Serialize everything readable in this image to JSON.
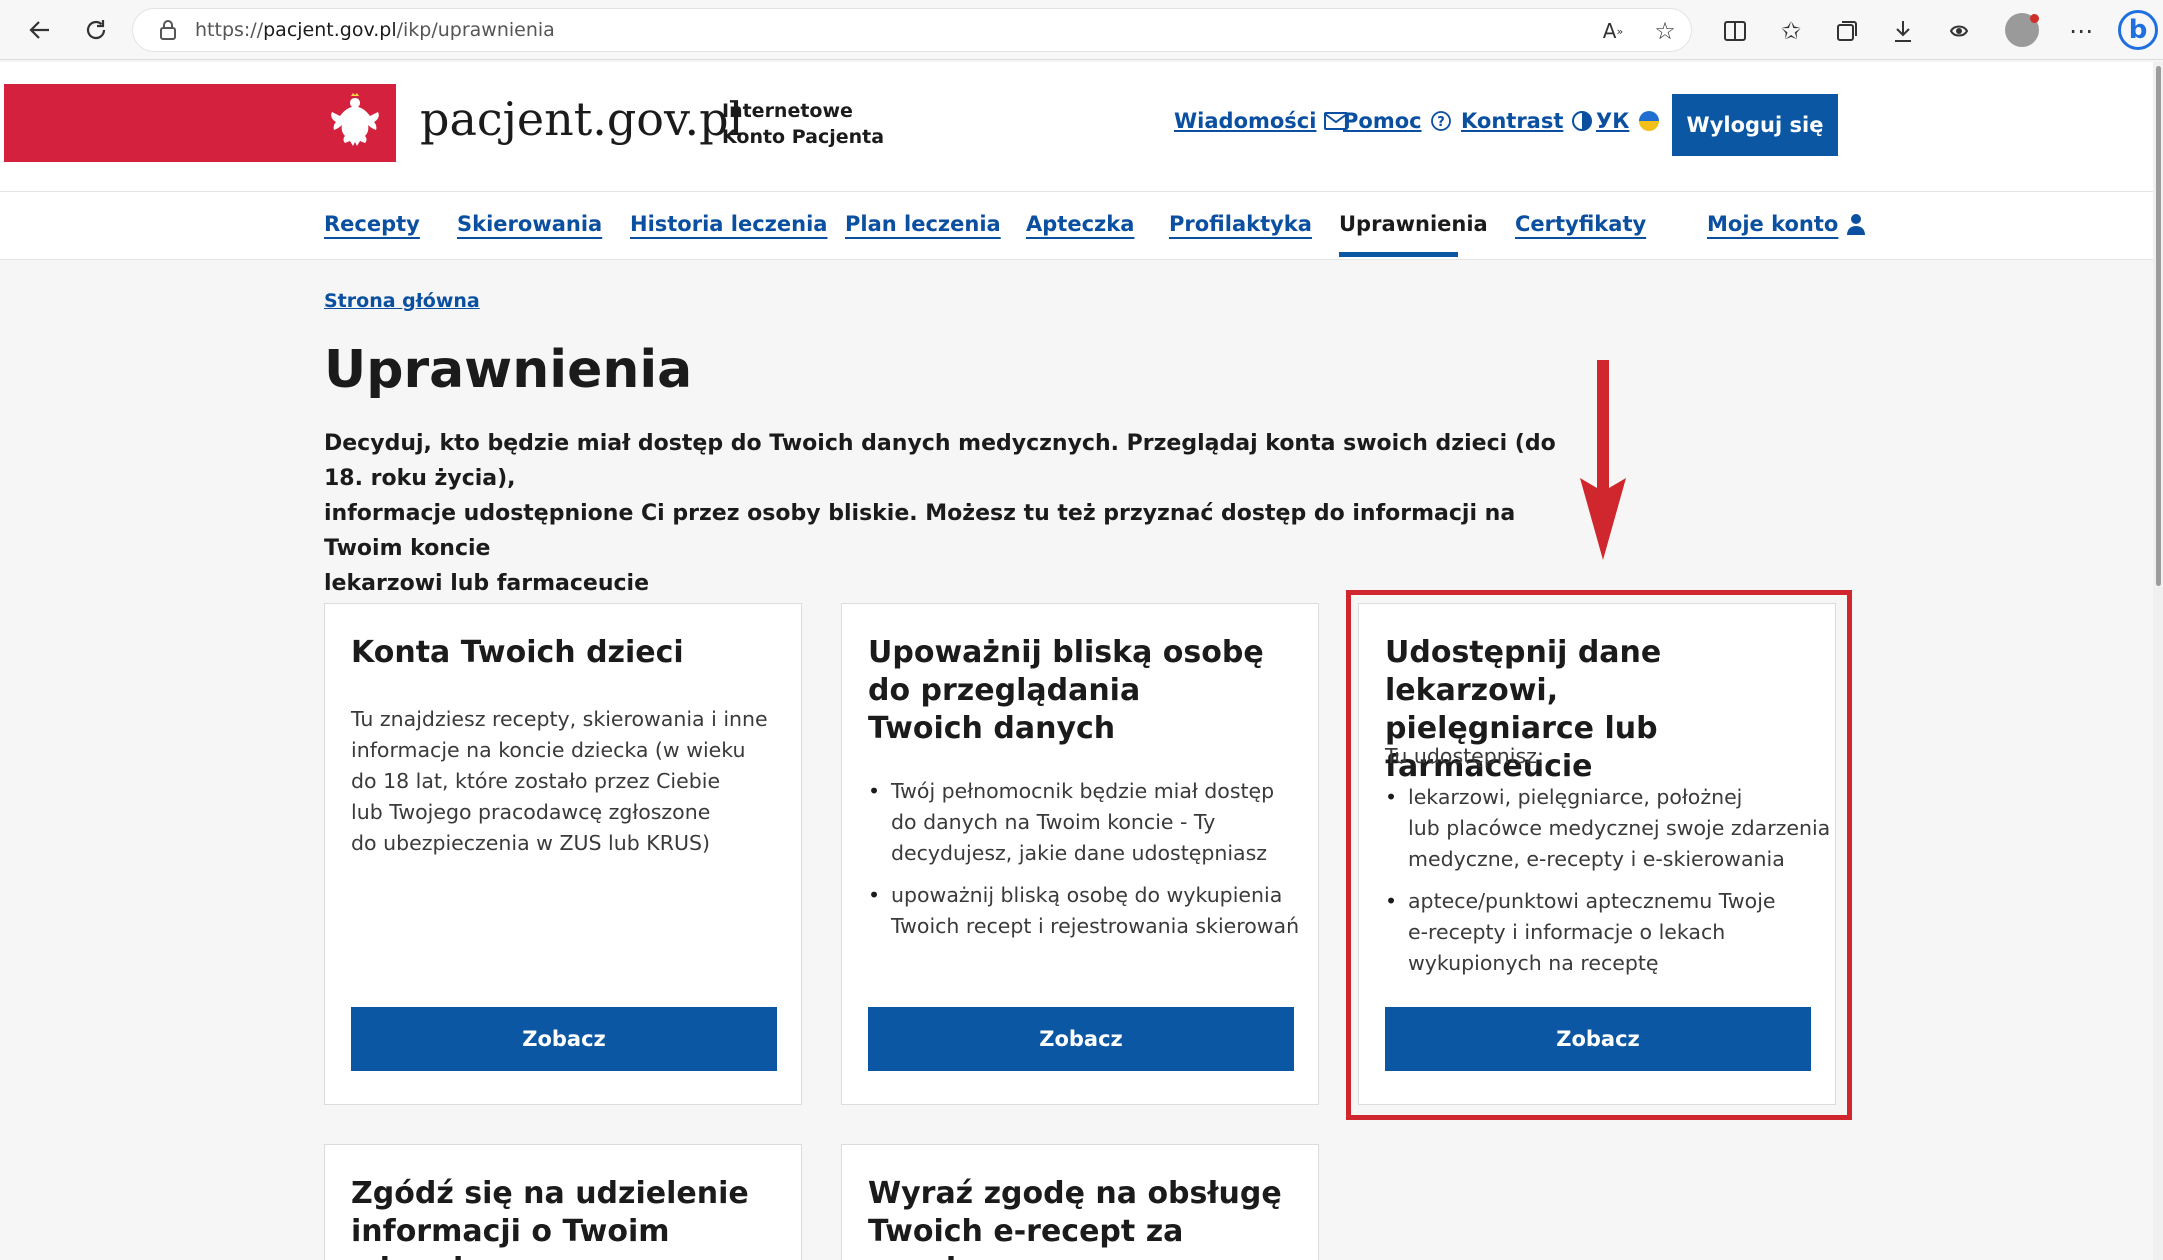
{
  "browser": {
    "url_prefix": "https://",
    "url_host": "pacjent.gov.pl",
    "url_path": "/ikp/uprawnienia"
  },
  "header": {
    "brand": "pacjent.gov.pl",
    "brand_sub_line1": "Internetowe",
    "brand_sub_line2": "Konto Pacjenta",
    "messages": "Wiadomości",
    "help": "Pomoc",
    "contrast": "Kontrast",
    "language": "УК",
    "logout": "Wyloguj się"
  },
  "nav": {
    "items": [
      {
        "label": "Recepty"
      },
      {
        "label": "Skierowania"
      },
      {
        "label": "Historia leczenia"
      },
      {
        "label": "Plan leczenia"
      },
      {
        "label": "Apteczka"
      },
      {
        "label": "Profilaktyka"
      },
      {
        "label": "Uprawnienia"
      },
      {
        "label": "Certyfikaty"
      },
      {
        "label": "Moje konto"
      }
    ],
    "active": "Uprawnienia"
  },
  "breadcrumb": "Strona główna",
  "page": {
    "title": "Uprawnienia",
    "lead_line1": "Decyduj, kto będzie miał dostęp do Twoich danych medycznych. Przeglądaj konta swoich dzieci (do 18. roku życia),",
    "lead_line2": "informacje udostępnione Ci przez osoby bliskie. Możesz tu też przyznać dostęp do informacji na Twoim koncie",
    "lead_line3": "lekarzowi lub farmaceucie"
  },
  "cards": [
    {
      "title": "Konta Twoich dzieci",
      "text_lines": [
        "Tu znajdziesz recepty, skierowania i inne",
        "informacje na koncie dziecka (w wieku",
        "do 18 lat, które zostało przez Ciebie",
        "lub Twojego pracodawcę zgłoszone",
        "do ubezpieczenia w ZUS lub KRUS)"
      ],
      "button": "Zobacz"
    },
    {
      "title_lines": [
        "Upoważnij bliską osobę",
        "do przeglądania",
        "Twoich danych"
      ],
      "bullets": [
        [
          "Twój pełnomocnik będzie miał dostęp",
          "do danych na Twoim koncie - Ty",
          "decydujesz, jakie dane udostępniasz"
        ],
        [
          "upoważnij bliską osobę do wykupienia",
          "Twoich recept i rejestrowania skierowań"
        ]
      ],
      "button": "Zobacz"
    },
    {
      "title_lines": [
        "Udostępnij dane lekarzowi,",
        "pielęgniarce lub farmaceucie"
      ],
      "intro": "Tu udostępnisz:",
      "bullets": [
        [
          "lekarzowi, pielęgniarce, położnej",
          "lub placówce medycznej swoje zdarzenia",
          "medyczne, e-recepty i e-skierowania"
        ],
        [
          "aptece/punktowi aptecznemu Twoje",
          "e-recepty i informacje o lekach",
          "wykupionych na receptę"
        ]
      ],
      "button": "Zobacz"
    },
    {
      "title_lines": [
        "Zgódź się na udzielenie",
        "informacji o Twoim zdrowiu"
      ]
    },
    {
      "title_lines": [
        "Wyraź zgodę na obsługę",
        "Twoich e-recept za granicą"
      ]
    }
  ],
  "colors": {
    "brand_red": "#d4213d",
    "link_blue": "#0b4fa0",
    "button_blue": "#0b57a4",
    "highlight_red": "#d0262d"
  }
}
